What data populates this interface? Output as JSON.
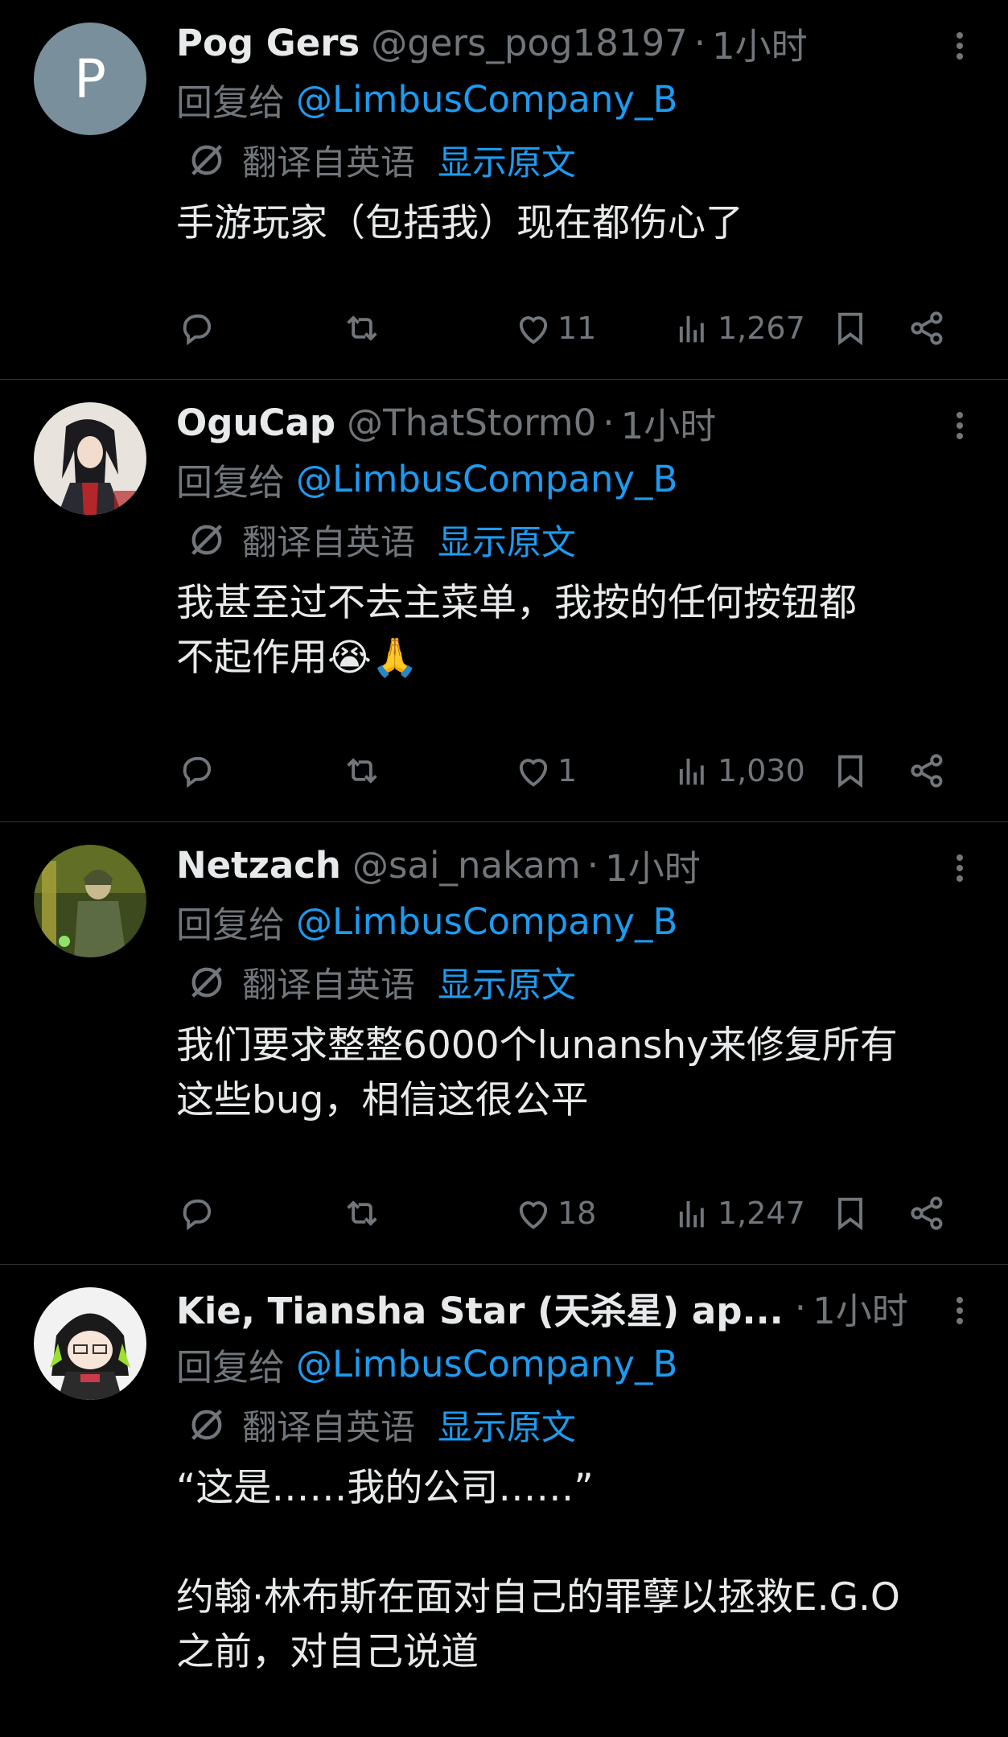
{
  "tweets": [
    {
      "display_name": "Pog Gers",
      "handle": "@gers_pog18197",
      "separator": "·",
      "time": "1小时",
      "avatar_letter": "P",
      "reply_prefix": "回复给",
      "reply_mention": "@LimbusCompany_B",
      "translated_label": "翻译自英语",
      "show_original": "显示原文",
      "text": "手游玩家（包括我）现在都伤心了",
      "likes": "11",
      "views": "1,267"
    },
    {
      "display_name": "OguCap",
      "handle": "@ThatStorm0",
      "separator": "·",
      "time": "1小时",
      "reply_prefix": "回复给",
      "reply_mention": "@LimbusCompany_B",
      "translated_label": "翻译自英语",
      "show_original": "显示原文",
      "text": "我甚至过不去主菜单，我按的任何按钮都\n不起作用😭🙏",
      "likes": "1",
      "views": "1,030"
    },
    {
      "display_name": "Netzach",
      "handle": "@sai_nakam",
      "separator": "·",
      "time": "1小时",
      "reply_prefix": "回复给",
      "reply_mention": "@LimbusCompany_B",
      "translated_label": "翻译自英语",
      "show_original": "显示原文",
      "text": "我们要求整整6000个lunanshy来修复所有\n这些bug，相信这很公平",
      "likes": "18",
      "views": "1,247"
    },
    {
      "display_name": "Kie, Tiansha Star (天杀星) ap...",
      "handle": "",
      "separator": "·",
      "time": "1小时",
      "reply_prefix": "回复给",
      "reply_mention": "@LimbusCompany_B",
      "translated_label": "翻译自英语",
      "show_original": "显示原文",
      "text": "“这是……我的公司……”\n\n约翰·林布斯在面对自己的罪孽以拯救E.G.O\n之前，对自己说道"
    }
  ],
  "colors": {
    "background": "#000000",
    "text": "#e7e9ea",
    "muted": "#71767b",
    "link": "#1d9bf0",
    "divider": "#2f3336"
  },
  "icons": [
    "more-icon",
    "reply-icon",
    "retweet-icon",
    "like-icon",
    "views-icon",
    "bookmark-icon",
    "share-icon",
    "translate-icon"
  ]
}
